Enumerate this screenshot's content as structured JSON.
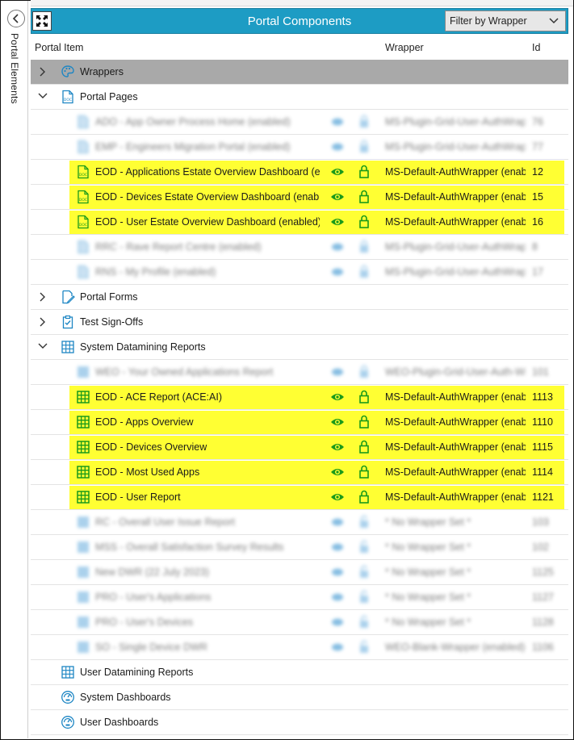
{
  "side_panel": {
    "label": "Portal Elements"
  },
  "header": {
    "title": "Portal Components",
    "filter": {
      "selected": "Filter by Wrapper"
    }
  },
  "columns": {
    "item": "Portal Item",
    "wrapper": "Wrapper",
    "id": "Id"
  },
  "colors": {
    "accent": "#1d9cc4",
    "highlight": "#ffff33",
    "icon_green": "#1a9a1a",
    "icon_blue": "#1d86c4"
  },
  "tree": {
    "wrappers": {
      "label": "Wrappers",
      "icon": "palette-icon"
    },
    "portal_pages": {
      "label": "Portal Pages",
      "icon": "page-icon",
      "items": [
        {
          "label": "ADO - App Owner Process Home (enabled)",
          "wrapper": "MS-Plugin-Grid-User-AuthWrapper",
          "id": "76"
        },
        {
          "label": "EMP - Engineers Migration Portal (enabled)",
          "wrapper": "MS-Plugin-Grid-User-AuthWrapper",
          "id": "77"
        },
        {
          "label": "EOD - Applications Estate Overview Dashboard (enabled)",
          "wrapper": "MS-Default-AuthWrapper (enabled)",
          "id": "12"
        },
        {
          "label": "EOD - Devices Estate Overview Dashboard (enabled)",
          "wrapper": "MS-Default-AuthWrapper (enabled)",
          "id": "15"
        },
        {
          "label": "EOD - User Estate Overview Dashboard (enabled)",
          "wrapper": "MS-Default-AuthWrapper (enabled)",
          "id": "16"
        },
        {
          "label": "RRC - Rave Report Centre (enabled)",
          "wrapper": "MS-Plugin-Grid-User-AuthWrapper",
          "id": "8"
        },
        {
          "label": "RNS - My Profile (enabled)",
          "wrapper": "MS-Plugin-Grid-User-AuthWrapper",
          "id": "17"
        }
      ]
    },
    "portal_forms": {
      "label": "Portal Forms",
      "icon": "form-edit-icon"
    },
    "test_signoffs": {
      "label": "Test Sign-Offs",
      "icon": "clipboard-check-icon"
    },
    "system_reports": {
      "label": "System Datamining Reports",
      "icon": "grid-icon",
      "items": [
        {
          "label": "WEO - Your Owned Applications Report",
          "wrapper": "WEO-Plugin-Grid-User-Auth-Wrapper",
          "id": "101"
        },
        {
          "label": "EOD - ACE Report (ACE:AI)",
          "wrapper": "MS-Default-AuthWrapper (enabled)",
          "id": "1113"
        },
        {
          "label": "EOD - Apps Overview",
          "wrapper": "MS-Default-AuthWrapper (enabled)",
          "id": "1110"
        },
        {
          "label": "EOD - Devices Overview",
          "wrapper": "MS-Default-AuthWrapper (enabled)",
          "id": "1115"
        },
        {
          "label": "EOD - Most Used Apps",
          "wrapper": "MS-Default-AuthWrapper (enabled)",
          "id": "1114"
        },
        {
          "label": "EOD - User Report",
          "wrapper": "MS-Default-AuthWrapper (enabled)",
          "id": "1121"
        },
        {
          "label": "RC - Overall User Issue Report",
          "wrapper": "* No Wrapper Set *",
          "id": "103"
        },
        {
          "label": "MSS - Overall Satisfaction Survey Results",
          "wrapper": "* No Wrapper Set *",
          "id": "102"
        },
        {
          "label": "New DWR (22 July 2023)",
          "wrapper": "* No Wrapper Set *",
          "id": "1125"
        },
        {
          "label": "PRO - User's Applications",
          "wrapper": "* No Wrapper Set *",
          "id": "1127"
        },
        {
          "label": "PRO - User's Devices",
          "wrapper": "* No Wrapper Set *",
          "id": "1128"
        },
        {
          "label": "SO - Single Device DWR",
          "wrapper": "WEO-Blank-Wrapper (enabled)",
          "id": "1106"
        }
      ]
    },
    "user_reports": {
      "label": "User Datamining Reports",
      "icon": "grid-icon"
    },
    "system_dashboards": {
      "label": "System Dashboards",
      "icon": "dashboard-icon"
    },
    "user_dashboards": {
      "label": "User Dashboards",
      "icon": "dashboard-icon"
    }
  }
}
